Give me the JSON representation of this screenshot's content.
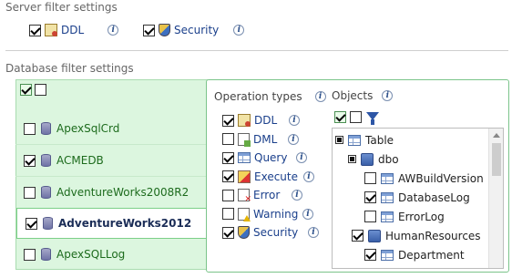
{
  "server": {
    "title": "Server filter settings",
    "items": [
      {
        "label": "DDL",
        "checked": true,
        "icon": "ddl-icon"
      },
      {
        "label": "Security",
        "checked": true,
        "icon": "shield-icon"
      }
    ]
  },
  "database": {
    "title": "Database filter settings",
    "list": [
      {
        "label": "ApexSqlCrd",
        "checked": false,
        "selected": false
      },
      {
        "label": "ACMEDB",
        "checked": true,
        "selected": false
      },
      {
        "label": "AdventureWorks2008R2",
        "checked": false,
        "selected": false
      },
      {
        "label": "AdventureWorks2012",
        "checked": true,
        "selected": true
      },
      {
        "label": "ApexSQLLog",
        "checked": false,
        "selected": false
      }
    ]
  },
  "operations": {
    "title": "Operation types",
    "items": [
      {
        "label": "DDL",
        "checked": true,
        "icon": "ddl-icon"
      },
      {
        "label": "DML",
        "checked": false,
        "icon": "dml-icon"
      },
      {
        "label": "Query",
        "checked": true,
        "icon": "table-icon"
      },
      {
        "label": "Execute",
        "checked": true,
        "icon": "execute-icon"
      },
      {
        "label": "Error",
        "checked": false,
        "icon": "error-icon"
      },
      {
        "label": "Warning",
        "checked": false,
        "icon": "warning-icon"
      },
      {
        "label": "Security",
        "checked": true,
        "icon": "shield-icon"
      }
    ]
  },
  "objects": {
    "title": "Objects",
    "tree": [
      {
        "label": "Table",
        "state": "partial",
        "icon": "table-icon"
      },
      {
        "label": "dbo",
        "state": "partial",
        "icon": "schema-icon"
      },
      {
        "label": "AWBuildVersion",
        "state": "unchecked",
        "icon": "table-icon"
      },
      {
        "label": "DatabaseLog",
        "state": "checked",
        "icon": "table-icon"
      },
      {
        "label": "ErrorLog",
        "state": "unchecked",
        "icon": "table-icon"
      },
      {
        "label": "HumanResources",
        "state": "checked",
        "icon": "schema-icon"
      },
      {
        "label": "Department",
        "state": "checked",
        "icon": "table-icon"
      }
    ]
  },
  "colors": {
    "panel_green": "#dcf6df",
    "link_blue": "#1a3f8b",
    "label_green": "#1d6b1d"
  }
}
